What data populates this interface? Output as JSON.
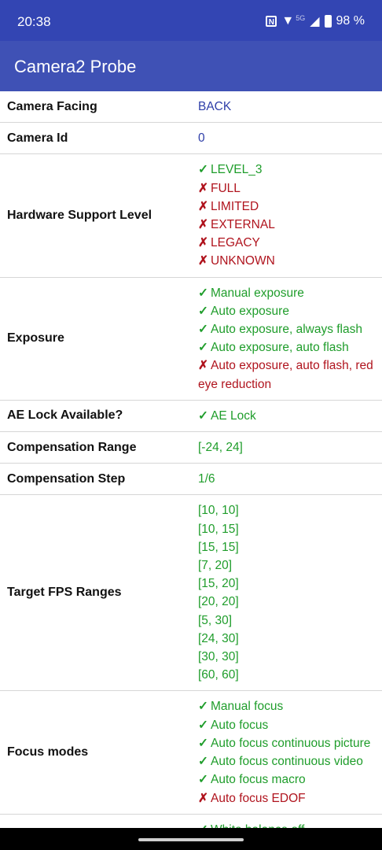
{
  "status_bar": {
    "time": "20:38",
    "network": "5G",
    "battery": "98 %"
  },
  "app_bar": {
    "title": "Camera2 Probe"
  },
  "rows": [
    {
      "label": "Camera Facing",
      "lines": [
        {
          "text": "BACK",
          "state": "neutral"
        }
      ]
    },
    {
      "label": "Camera Id",
      "lines": [
        {
          "text": "0",
          "state": "neutral"
        }
      ]
    },
    {
      "label": "Hardware Support Level",
      "lines": [
        {
          "text": "LEVEL_3",
          "state": "ok"
        },
        {
          "text": "FULL",
          "state": "no"
        },
        {
          "text": "LIMITED",
          "state": "no"
        },
        {
          "text": "EXTERNAL",
          "state": "no"
        },
        {
          "text": "LEGACY",
          "state": "no"
        },
        {
          "text": "UNKNOWN",
          "state": "no"
        }
      ]
    },
    {
      "label": "Exposure",
      "lines": [
        {
          "text": "Manual exposure",
          "state": "ok"
        },
        {
          "text": "Auto exposure",
          "state": "ok"
        },
        {
          "text": "Auto exposure, always flash",
          "state": "ok"
        },
        {
          "text": "Auto exposure, auto flash",
          "state": "ok"
        },
        {
          "text": "Auto exposure, auto flash, red eye reduction",
          "state": "no"
        }
      ]
    },
    {
      "label": "AE Lock Available?",
      "lines": [
        {
          "text": "AE Lock",
          "state": "ok"
        }
      ]
    },
    {
      "label": "Compensation Range",
      "lines": [
        {
          "text": "[-24, 24]",
          "state": "plain"
        }
      ]
    },
    {
      "label": "Compensation Step",
      "lines": [
        {
          "text": "1/6",
          "state": "plain"
        }
      ]
    },
    {
      "label": "Target FPS Ranges",
      "lines": [
        {
          "text": "[10, 10]",
          "state": "plain"
        },
        {
          "text": "[10, 15]",
          "state": "plain"
        },
        {
          "text": "[15, 15]",
          "state": "plain"
        },
        {
          "text": "[7, 20]",
          "state": "plain"
        },
        {
          "text": "[15, 20]",
          "state": "plain"
        },
        {
          "text": "[20, 20]",
          "state": "plain"
        },
        {
          "text": "[5, 30]",
          "state": "plain"
        },
        {
          "text": "[24, 30]",
          "state": "plain"
        },
        {
          "text": "[30, 30]",
          "state": "plain"
        },
        {
          "text": "[60, 60]",
          "state": "plain"
        }
      ]
    },
    {
      "label": "Focus modes",
      "lines": [
        {
          "text": "Manual focus",
          "state": "ok"
        },
        {
          "text": "Auto focus",
          "state": "ok"
        },
        {
          "text": "Auto focus continuous picture",
          "state": "ok"
        },
        {
          "text": "Auto focus continuous video",
          "state": "ok"
        },
        {
          "text": "Auto focus macro",
          "state": "ok"
        },
        {
          "text": "Auto focus EDOF",
          "state": "no"
        }
      ]
    },
    {
      "label": "",
      "lines": [
        {
          "text": "White balance off",
          "state": "ok"
        }
      ]
    }
  ],
  "marks": {
    "ok": "✓",
    "no": "✗"
  },
  "colors": {
    "status_bar": "#3345b3",
    "app_bar": "#3f51b5",
    "ok": "#1f9d2b",
    "no": "#b0141e",
    "neutral": "#2e3ea8"
  }
}
